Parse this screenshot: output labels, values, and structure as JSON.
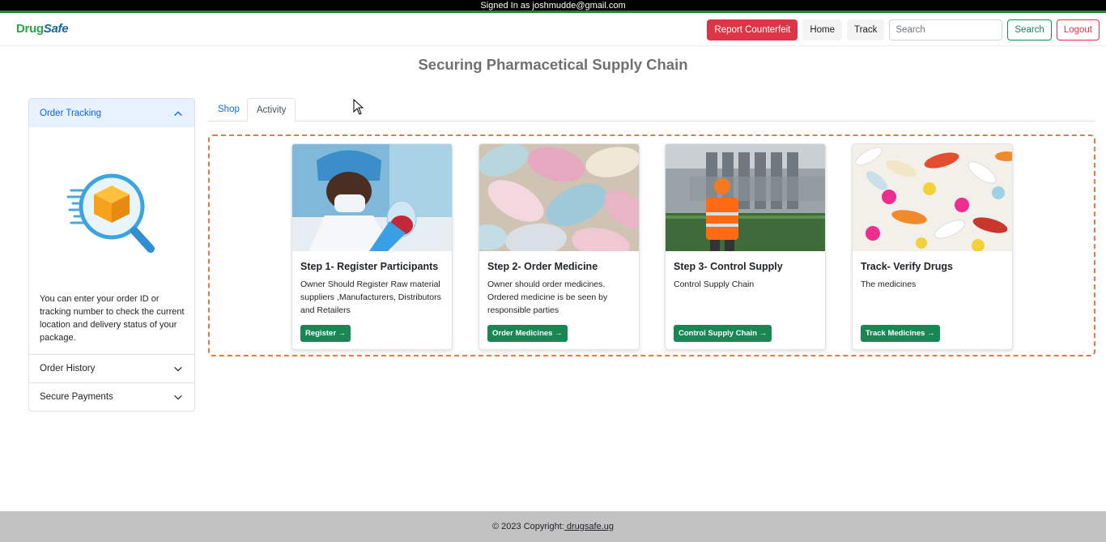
{
  "topbar": {
    "signed_in": "Signed In as joshmudde@gmail.com"
  },
  "navbar": {
    "brand_drug": "Drug",
    "brand_safe": "Safe",
    "report_label": "Report Counterfeit",
    "home_label": "Home",
    "track_label": "Track",
    "search_placeholder": "Search",
    "search_button": "Search",
    "logout_label": "Logout",
    "colors": {
      "report": "#dc3545",
      "search": "#198754",
      "logout": "#dc3545"
    }
  },
  "page_title": "Securing Pharmacetical Supply Chain",
  "sidebar": {
    "order_tracking": {
      "title": "Order Tracking",
      "description": "You can enter your order ID or tracking number to check the current location and delivery status of your package."
    },
    "order_history": {
      "title": "Order History"
    },
    "secure_payments": {
      "title": "Secure Payments"
    }
  },
  "tabs": [
    {
      "label": "Shop"
    },
    {
      "label": "Activity"
    }
  ],
  "cards": [
    {
      "title": "Step 1- Register Participants",
      "text": "Owner Should Register Raw material suppliers ,Manufacturers, Distributors and Retailers",
      "button": "Register",
      "image": "scientist-lab"
    },
    {
      "title": "Step 2- Order Medicine",
      "text": "Owner should order medicines. Ordered medicine is be seen by responsible parties",
      "button": "Order Medicines",
      "image": "pastel-pills"
    },
    {
      "title": "Step 3- Control Supply",
      "text": "Control Supply Chain",
      "button": "Control Supply Chain",
      "image": "factory-worker"
    },
    {
      "title": "Track- Verify Drugs",
      "text": "The medicines",
      "button": "Track Medicines",
      "image": "colorful-pills"
    }
  ],
  "footer": {
    "prefix": "© 2023 Copyright:",
    "link": "  drugsafe.ug"
  }
}
